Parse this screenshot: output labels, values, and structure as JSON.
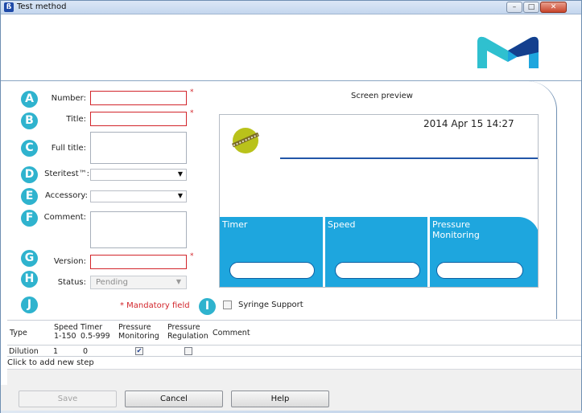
{
  "window": {
    "title": "Test method",
    "app_icon": "app-icon",
    "buttons": [
      "minimize-icon",
      "maximize-icon",
      "close-icon"
    ]
  },
  "form": {
    "markers": [
      "A",
      "B",
      "C",
      "D",
      "E",
      "F",
      "G",
      "H",
      "J",
      "I"
    ],
    "number_label": "Number:",
    "number_value": "",
    "title_label": "Title:",
    "title_value": "",
    "full_title_label": "Full title:",
    "full_title_value": "",
    "steritest_label": "Steritest™:",
    "steritest_value": "",
    "accessory_label": "Accessory:",
    "accessory_value": "",
    "comment_label": "Comment:",
    "comment_value": "",
    "version_label": "Version:",
    "version_value": "",
    "status_label": "Status:",
    "status_value": "Pending",
    "required_mark": "*",
    "mandatory_note": "* Mandatory field"
  },
  "preview": {
    "title": "Screen preview",
    "datetime": "2014 Apr 15   14:27",
    "tiles": [
      {
        "label": "Timer"
      },
      {
        "label": "Speed"
      },
      {
        "label": "Pressure Monitoring"
      }
    ],
    "accent_color": "#1ea6de",
    "line_color": "#2256a8"
  },
  "syringe": {
    "label": "Syringe Support",
    "checked": false
  },
  "steps_table": {
    "columns": [
      {
        "label": "Type"
      },
      {
        "label": "Speed 1-150"
      },
      {
        "label": "Timer 0.5-999"
      },
      {
        "label": "Pressure Monitoring"
      },
      {
        "label": "Pressure Regulation"
      },
      {
        "label": "Comment"
      }
    ],
    "rows": [
      {
        "type": "Dilution",
        "speed": "1",
        "timer": "0",
        "pressure_monitoring": true,
        "pressure_regulation": false,
        "comment": ""
      }
    ],
    "add_step_text": "Click to add new step"
  },
  "buttons": {
    "save": "Save",
    "cancel": "Cancel",
    "help": "Help"
  },
  "colors": {
    "required_border": "#d2252b",
    "marker": "#2fb3ce",
    "frame": "#6f8fb2"
  }
}
